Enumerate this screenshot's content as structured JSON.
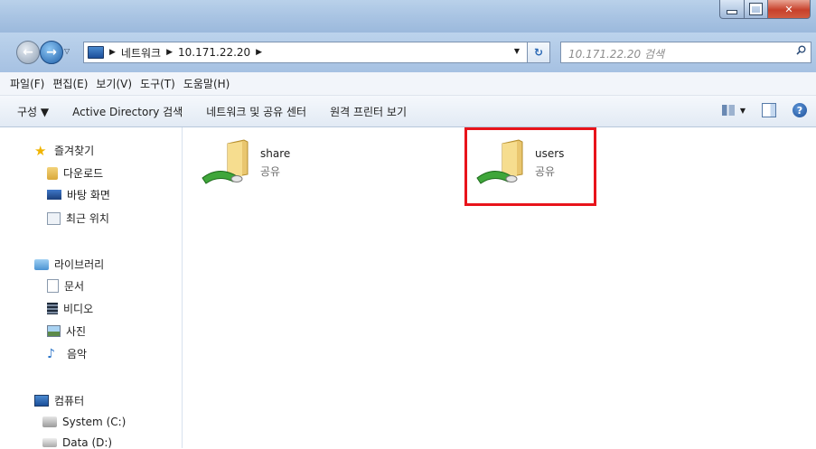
{
  "address": {
    "crumbs": [
      "네트워크",
      "10.171.22.20"
    ],
    "search_placeholder": "10.171.22.20 검색"
  },
  "menu": [
    "파일(F)",
    "편집(E)",
    "보기(V)",
    "도구(T)",
    "도움말(H)"
  ],
  "commands": {
    "organize": "구성 ▼",
    "active_directory": "Active Directory 검색",
    "network_center": "네트워크 및 공유 센터",
    "remote_printers": "원격 프린터 보기"
  },
  "nav": {
    "favorites": "즐겨찾기",
    "downloads": "다운로드",
    "desktop": "바탕 화면",
    "recent": "최근 위치",
    "libraries": "라이브러리",
    "documents": "문서",
    "videos": "비디오",
    "pictures": "사진",
    "music": "음악",
    "computer": "컴퓨터",
    "system": "System (C:)",
    "data": "Data (D:)"
  },
  "shares": [
    {
      "name": "share",
      "type": "공유"
    },
    {
      "name": "users",
      "type": "공유"
    }
  ]
}
